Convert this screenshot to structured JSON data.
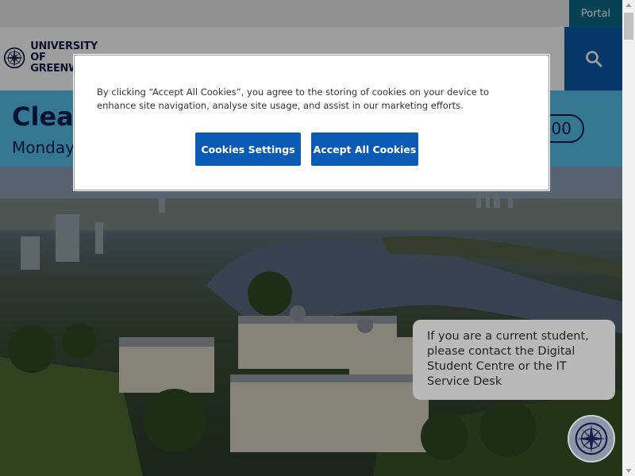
{
  "topbar": {
    "portal_label": "Portal"
  },
  "header": {
    "logo_line1": "UNIVERSITY OF",
    "logo_line2": "GREENWICH",
    "search_icon": "search-icon"
  },
  "banner": {
    "title": "Clearing",
    "subtitle": "Monday",
    "phone": "000"
  },
  "cookie_modal": {
    "text": "By clicking “Accept All Cookies”, you agree to the storing of cookies on your device to enhance site navigation, analyse site usage, and assist in our marketing efforts.",
    "settings_label": "Cookies Settings",
    "accept_label": "Accept All Cookies"
  },
  "chat": {
    "message": "If you are a current student, please contact the Digital Student Centre or the IT Service Desk",
    "launcher_icon": "compass-icon"
  },
  "colors": {
    "portal_bg": "#0a6a86",
    "search_bg": "#0b5aa8",
    "banner_bg": "#56c0ec",
    "button_bg": "#0b5ab5"
  }
}
